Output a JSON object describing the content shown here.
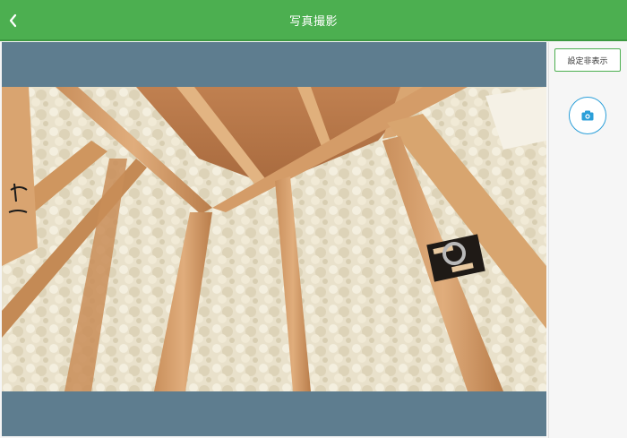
{
  "header": {
    "title": "写真撮影",
    "back_icon": "chevron-left-icon"
  },
  "sidepanel": {
    "toggle_label": "設定非表示",
    "shutter_icon": "camera-icon",
    "accent_color": "#2b9fd9"
  },
  "theme": {
    "header_color": "#4caf50",
    "viewer_bg": "#5e7d8f"
  }
}
